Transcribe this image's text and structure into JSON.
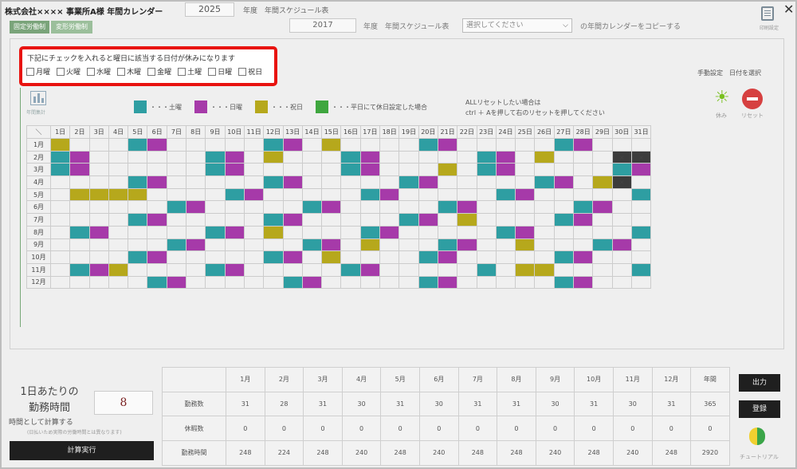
{
  "header": {
    "company": "株式会社×××× 事業所A様 年間カレンダー",
    "year": "2025",
    "year_label": "年度　年間スケジュール表",
    "tabs": [
      "固定労働制",
      "変形労働制"
    ],
    "doc_label": "印刷設定"
  },
  "copy": {
    "year": "2017",
    "label": "年度　年間スケジュール表",
    "select_placeholder": "選択してください",
    "suffix": "の年間カレンダーをコピーする"
  },
  "callout": {
    "text": "下記にチェックを入れると曜日に該当する日付が休みになります",
    "days": [
      "月曜",
      "火曜",
      "水曜",
      "木曜",
      "金曜",
      "土曜",
      "日曜",
      "祝日"
    ]
  },
  "manual": "手動設定　日付を選択",
  "bar_icon_label": "年間集計",
  "legend": [
    {
      "color": "#2e9ea2",
      "text": "・・・土曜"
    },
    {
      "color": "#a63aa9",
      "text": "・・・日曜"
    },
    {
      "color": "#b6a81c",
      "text": "・・・祝日"
    },
    {
      "color": "#3fa63f",
      "text": "・・・平日にて休日設定した場合"
    }
  ],
  "allreset": {
    "line1": "ALLリセットしたい場合は",
    "line2": "ctrl ＋ Aを押して右のリセットを押してください"
  },
  "buttons": {
    "holiday": "休み",
    "reset": "リセット",
    "calc": "計算実行",
    "output": "出力",
    "register": "登録",
    "tutorial": "チュートリアル"
  },
  "calendar": {
    "corner": "＼",
    "days": [
      "1日",
      "2日",
      "3日",
      "4日",
      "5日",
      "6日",
      "7日",
      "8日",
      "9日",
      "10日",
      "11日",
      "12日",
      "13日",
      "14日",
      "15日",
      "16日",
      "17日",
      "18日",
      "19日",
      "20日",
      "21日",
      "22日",
      "23日",
      "24日",
      "25日",
      "26日",
      "27日",
      "28日",
      "29日",
      "30日",
      "31日"
    ],
    "months": [
      "1月",
      "2月",
      "3月",
      "4月",
      "5月",
      "6月",
      "7月",
      "8月",
      "9月",
      "10月",
      "11月",
      "12月"
    ],
    "rows": [
      "h...su.....su.h....su.....su..",
      "su......su.h...su.....su.h...xxx",
      "su......su.....su...h.su.....su.",
      "....su.....su.....su.....su.hx",
      ".hhhh....su.....su.....su.....s",
      "......su.....su.....su.....su..",
      "....su.....su.....su.h....su.....",
      ".su.....su.h....su.....su.....su",
      "......su.....su.h...su..h...su.x",
      "....su.....su.h....su.....su..",
      ".suh....su.....su.....s.hh....sx",
      ".....su.....su.....su.....su..."
    ]
  },
  "daily": {
    "title": "1日あたりの\n勤務時間",
    "hours": "8",
    "note": "時間として計算する",
    "note2": "(日払いため実際の労働時間とは異なります)"
  },
  "summary": {
    "headers": [
      "1月",
      "2月",
      "3月",
      "4月",
      "5月",
      "6月",
      "7月",
      "8月",
      "9月",
      "10月",
      "11月",
      "12月",
      "年間"
    ],
    "rows": [
      {
        "label": "勤務数",
        "values": [
          "31",
          "28",
          "31",
          "30",
          "31",
          "30",
          "31",
          "31",
          "30",
          "31",
          "30",
          "31",
          "365"
        ]
      },
      {
        "label": "休暇数",
        "values": [
          "0",
          "0",
          "0",
          "0",
          "0",
          "0",
          "0",
          "0",
          "0",
          "0",
          "0",
          "0",
          "0"
        ]
      },
      {
        "label": "勤務時間",
        "values": [
          "248",
          "224",
          "248",
          "240",
          "248",
          "240",
          "248",
          "248",
          "240",
          "248",
          "240",
          "248",
          "2920"
        ]
      }
    ]
  }
}
